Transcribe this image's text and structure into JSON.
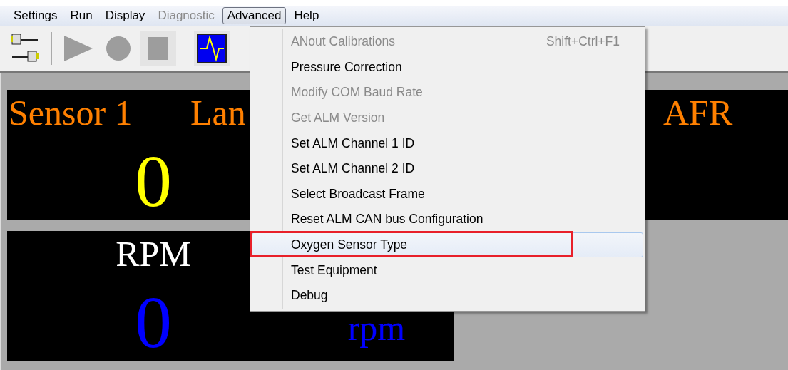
{
  "menubar": [
    {
      "label": "Settings",
      "disabled": false,
      "selected": false
    },
    {
      "label": "Run",
      "disabled": false,
      "selected": false
    },
    {
      "label": "Display",
      "disabled": false,
      "selected": false
    },
    {
      "label": "Diagnostic",
      "disabled": true,
      "selected": false
    },
    {
      "label": "Advanced",
      "disabled": false,
      "selected": true
    },
    {
      "label": "Help",
      "disabled": false,
      "selected": false
    }
  ],
  "toolbar": [
    {
      "kind": "connect",
      "pressed": false
    },
    {
      "kind": "play",
      "pressed": false
    },
    {
      "kind": "record",
      "pressed": false
    },
    {
      "kind": "stop",
      "pressed": true
    },
    {
      "kind": "scope",
      "pressed": true
    }
  ],
  "gauges": [
    {
      "headers": [
        "Sensor 1",
        "Lan",
        "AFR"
      ],
      "value": "0"
    },
    {
      "headers": [
        "RPM"
      ],
      "value": "0",
      "unit": "rpm"
    }
  ],
  "menu": {
    "items": [
      {
        "label": "ANout Calibrations",
        "shortcut": "Shift+Ctrl+F1",
        "disabled": true,
        "selected": false,
        "marked": false
      },
      {
        "label": "Pressure Correction",
        "disabled": false,
        "selected": false,
        "marked": false
      },
      {
        "label": "Modify COM Baud Rate",
        "disabled": true,
        "selected": false,
        "marked": false
      },
      {
        "label": "Get ALM Version",
        "disabled": true,
        "selected": false,
        "marked": false
      },
      {
        "label": "Set ALM Channel 1 ID",
        "disabled": false,
        "selected": false,
        "marked": false
      },
      {
        "label": "Set ALM Channel 2 ID",
        "disabled": false,
        "selected": false,
        "marked": false
      },
      {
        "label": "Select Broadcast Frame",
        "disabled": false,
        "selected": false,
        "marked": false
      },
      {
        "label": "Reset ALM CAN bus Configuration",
        "disabled": false,
        "selected": false,
        "marked": false
      },
      {
        "label": "Oxygen Sensor Type",
        "disabled": false,
        "selected": true,
        "marked": true
      },
      {
        "label": "Test Equipment",
        "disabled": false,
        "selected": false,
        "marked": false
      },
      {
        "label": "Debug",
        "disabled": false,
        "selected": false,
        "marked": false
      }
    ]
  }
}
